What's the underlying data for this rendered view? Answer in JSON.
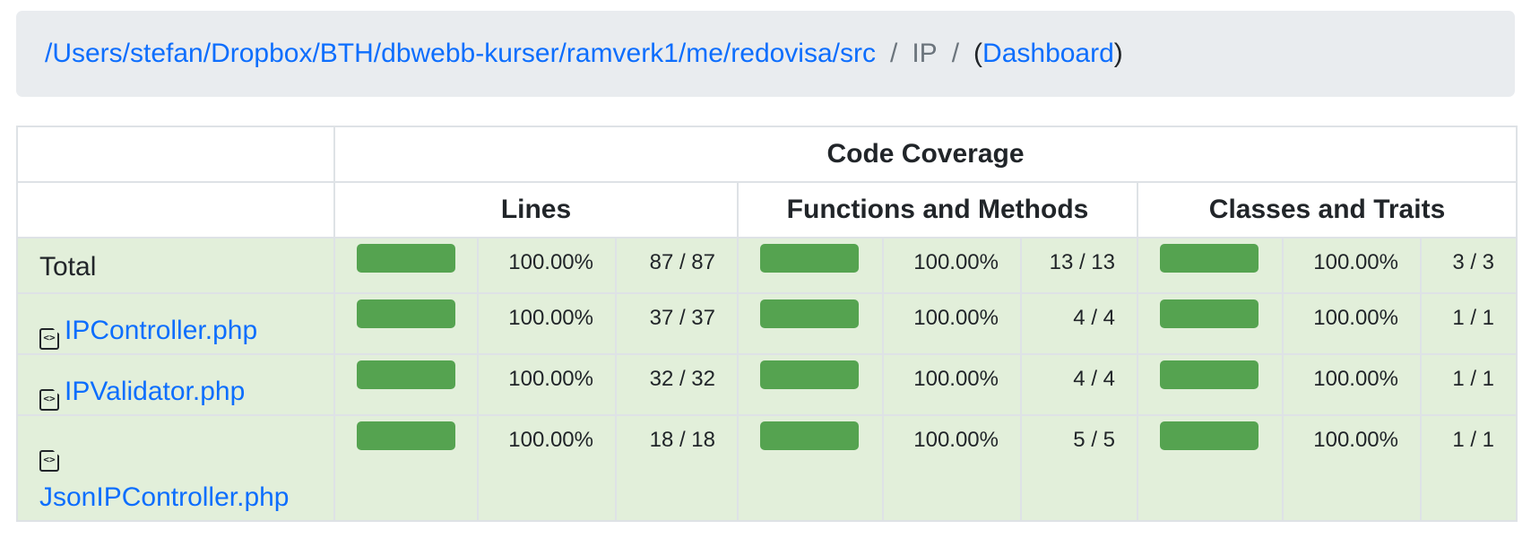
{
  "breadcrumb": {
    "path_link": "/Users/stefan/Dropbox/BTH/dbwebb-kurser/ramverk1/me/redovisa/src",
    "separator": "/",
    "current": "IP",
    "paren_open": "(",
    "dashboard_link": "Dashboard",
    "paren_close": ")"
  },
  "table": {
    "header_main": "Code Coverage",
    "col_lines": "Lines",
    "col_functions": "Functions and Methods",
    "col_classes": "Classes and Traits",
    "colors": {
      "high": "#55a350",
      "row_bg": "#e2efda",
      "link": "#0d6efd"
    },
    "rows": [
      {
        "name": "Total",
        "is_file": false,
        "lines": {
          "fraction": 1.0,
          "percent": "100.00%",
          "count": "87 / 87"
        },
        "functions": {
          "fraction": 1.0,
          "percent": "100.00%",
          "count": "13 / 13"
        },
        "classes": {
          "fraction": 1.0,
          "percent": "100.00%",
          "count": "3 / 3"
        }
      },
      {
        "name": "IPController.php",
        "is_file": true,
        "icon": "code-file-icon",
        "lines": {
          "fraction": 1.0,
          "percent": "100.00%",
          "count": "37 / 37"
        },
        "functions": {
          "fraction": 1.0,
          "percent": "100.00%",
          "count": "4 / 4"
        },
        "classes": {
          "fraction": 1.0,
          "percent": "100.00%",
          "count": "1 / 1"
        }
      },
      {
        "name": "IPValidator.php",
        "is_file": true,
        "icon": "code-file-icon",
        "lines": {
          "fraction": 1.0,
          "percent": "100.00%",
          "count": "32 / 32"
        },
        "functions": {
          "fraction": 1.0,
          "percent": "100.00%",
          "count": "4 / 4"
        },
        "classes": {
          "fraction": 1.0,
          "percent": "100.00%",
          "count": "1 / 1"
        }
      },
      {
        "name": "JsonIPController.php",
        "is_file": true,
        "icon": "code-file-icon",
        "lines": {
          "fraction": 1.0,
          "percent": "100.00%",
          "count": "18 / 18"
        },
        "functions": {
          "fraction": 1.0,
          "percent": "100.00%",
          "count": "5 / 5"
        },
        "classes": {
          "fraction": 1.0,
          "percent": "100.00%",
          "count": "1 / 1"
        }
      }
    ]
  }
}
